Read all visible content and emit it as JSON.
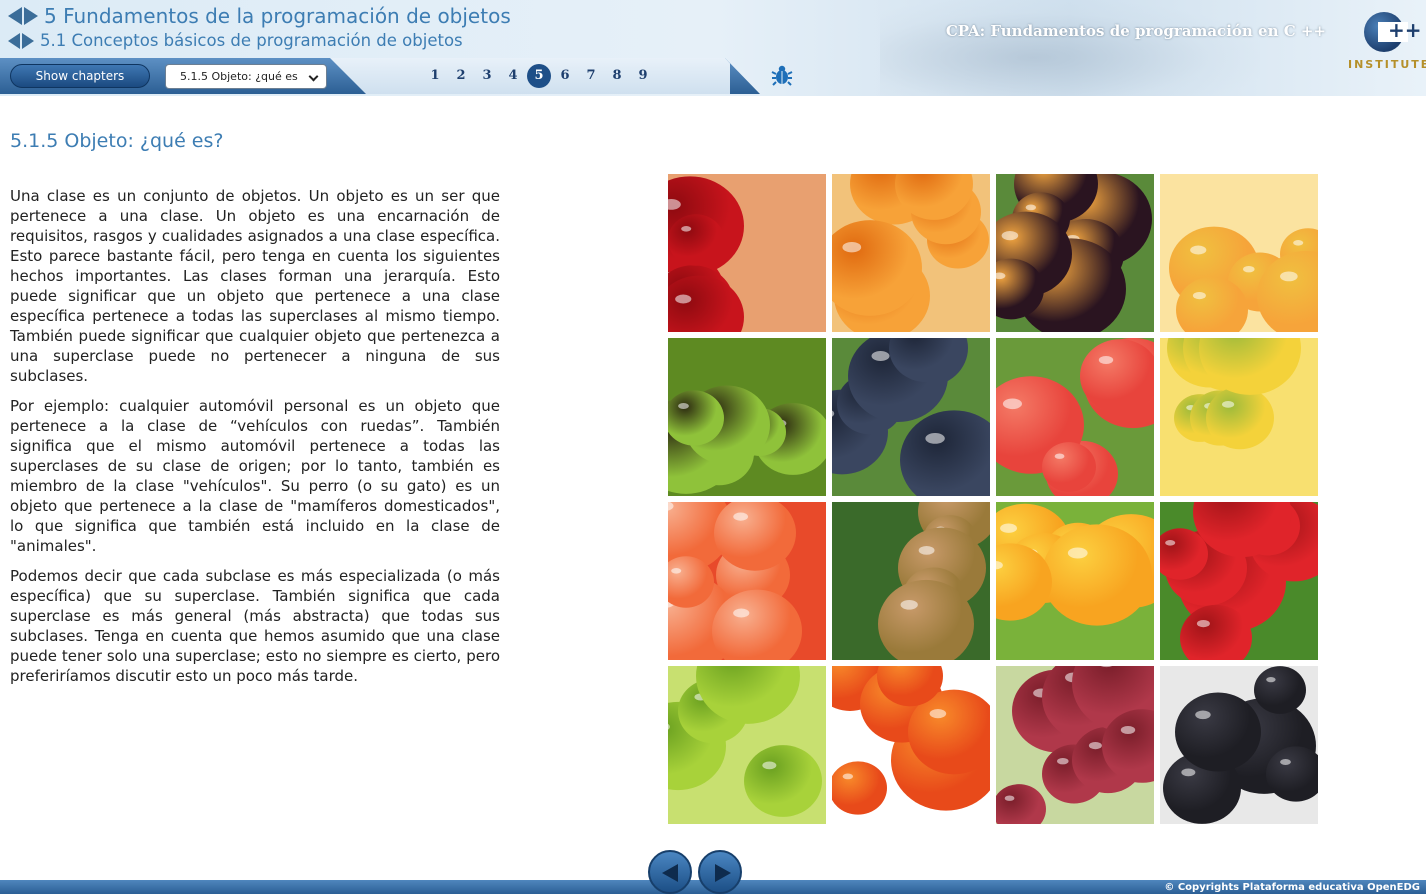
{
  "header": {
    "chapter_title": "5 Fundamentos de la programación de objetos",
    "section_title": "5.1 Conceptos básicos de programación de objetos",
    "course_title": "CPA: Fundamentos de programación en C ++",
    "logo_text": "INSTITUTE"
  },
  "toolbar": {
    "show_chapters_label": "Show chapters",
    "lesson_select_value": "5.1.5 Objeto: ¿qué es",
    "pages": [
      "1",
      "2",
      "3",
      "4",
      "5",
      "6",
      "7",
      "8",
      "9"
    ],
    "active_page": "5"
  },
  "content": {
    "heading": "5.1.5 Objeto: ¿qué es?",
    "paragraphs": [
      "Una clase es un conjunto de objetos. Un objeto es un ser que pertenece a una clase. Un objeto es una encarnación de requisitos, rasgos y cualidades asignados a una clase específica. Esto parece bastante fácil, pero tenga en cuenta los siguientes hechos importantes. Las clases forman una jerarquía. Esto puede significar que un objeto que pertenece a una clase específica pertenece a todas las superclases al mismo tiempo. También puede significar que cualquier objeto que pertenezca a una superclase puede no pertenecer a ninguna de sus subclases.",
      "Por ejemplo: cualquier automóvil personal es un objeto que pertenece a la clase de “vehículos con ruedas”. También significa que el mismo automóvil pertenece a todas las superclases de su clase de origen; por lo tanto, también es miembro de la clase \"vehículos\". Su perro (o su gato) es un objeto que pertenece a la clase de \"mamíferos domesticados\", lo que significa que también está incluido en la clase de \"animales\".",
      "Podemos decir que cada subclase es más especializada (o más específica) que su superclase. También significa que cada superclase es más general (más abstracta) que todas sus subclases. Tenga en cuenta que hemos asumido que una clase puede tener solo una superclase; esto no siempre es cierto, pero preferiríamos discutir esto un poco más tarde."
    ]
  },
  "fruits": [
    {
      "name": "cherries",
      "c1": "#c8141c",
      "c2": "#8e0a10",
      "bg": "#e8a070"
    },
    {
      "name": "apricots",
      "c1": "#f7a238",
      "c2": "#e06a10",
      "bg": "#f2c27a"
    },
    {
      "name": "plums",
      "c1": "#2a1420",
      "c2": "#f2a540",
      "bg": "#5a8a3a"
    },
    {
      "name": "melon",
      "c1": "#f6a43a",
      "c2": "#f0c040",
      "bg": "#fbe3a0"
    },
    {
      "name": "kiwi",
      "c1": "#8fc23a",
      "c2": "#2c2a10",
      "bg": "#5e8a22"
    },
    {
      "name": "blueberries",
      "c1": "#3a4660",
      "c2": "#1e2638",
      "bg": "#5a8a3a"
    },
    {
      "name": "watermelon",
      "c1": "#e8443c",
      "c2": "#f47a66",
      "bg": "#6a9a3a"
    },
    {
      "name": "banana",
      "c1": "#f4d23a",
      "c2": "#9cba3a",
      "bg": "#f8e070"
    },
    {
      "name": "grapefruit",
      "c1": "#f26a3a",
      "c2": "#f8b090",
      "bg": "#e84a2a"
    },
    {
      "name": "figs",
      "c1": "#9a7a3a",
      "c2": "#c89a6a",
      "bg": "#3a6a2a"
    },
    {
      "name": "orange",
      "c1": "#f8a420",
      "c2": "#fcd040",
      "bg": "#7ab23a"
    },
    {
      "name": "strawberries",
      "c1": "#e0242a",
      "c2": "#a01418",
      "bg": "#4a8a2a"
    },
    {
      "name": "apple",
      "c1": "#a8d23a",
      "c2": "#6aa020",
      "bg": "#c8e070"
    },
    {
      "name": "persimmon",
      "c1": "#e84a1a",
      "c2": "#f88a2a",
      "bg": "#ffffff"
    },
    {
      "name": "grapes",
      "c1": "#b0384a",
      "c2": "#7a1e2a",
      "bg": "#c8d8a0"
    },
    {
      "name": "blackberries",
      "c1": "#1e1e24",
      "c2": "#3a3a44",
      "bg": "#e8e8e8"
    }
  ],
  "footer": {
    "copyright": "© Copyrights Plataforma educativa OpenEDG"
  },
  "colors": {
    "accent": "#3d7db3",
    "toolbar": "#2c5f94",
    "active_page": "#1e4f88"
  }
}
